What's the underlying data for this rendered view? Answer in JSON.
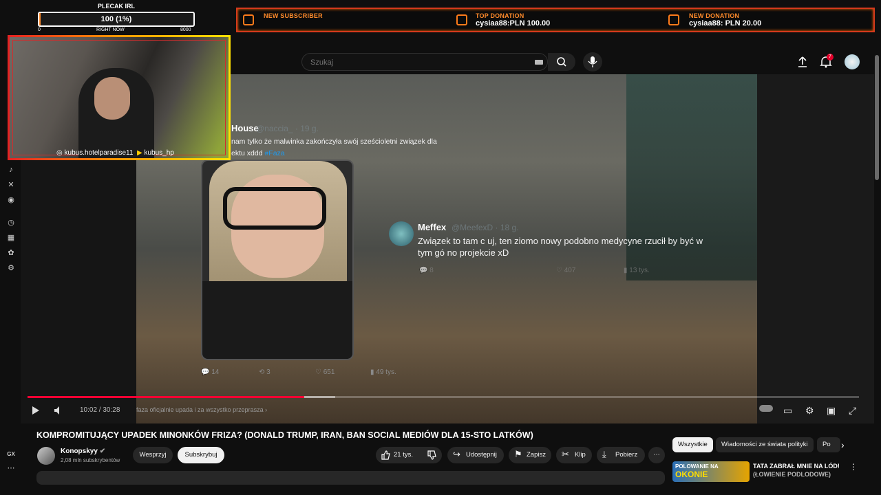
{
  "overlay": {
    "hud": {
      "title": "PLECAK IRL",
      "value_text": "100 (1%)",
      "progress_fraction": 0.01,
      "min_label": "0",
      "mid_label": "RIGHT NOW",
      "max_label": "8000"
    },
    "alerts": [
      {
        "title": "NEW SUBSCRIBER",
        "value": ""
      },
      {
        "title": "TOP DONATION",
        "value": "cysiaa88:PLN 100.00"
      },
      {
        "title": "NEW DONATION",
        "value": "cysiaa88: PLN 20.00"
      }
    ],
    "cam": {
      "instagram": "kubus.hotelparadise11",
      "youtube": "kubus_hp"
    },
    "accent_color": "#ff8a2a"
  },
  "left_rail": {
    "bottom_label": "GX"
  },
  "header": {
    "search_placeholder": "Szukaj",
    "notification_count": "7"
  },
  "video": {
    "tweet1": {
      "name": "House",
      "handle": "@naccia_ · 19 g.",
      "text_1": "nam tylko że malwinka zakończyła swój sześcioletni związek dla",
      "text_2": "ektu xddd",
      "hashtag": "#Faza",
      "stats": {
        "replies": "14",
        "retweets": "3",
        "likes": "651",
        "views": "49 tys."
      }
    },
    "tweet2": {
      "name": "Meffex",
      "handle": "@MeefexD · 18 g.",
      "text_1": "Związek to tam c   uj, ten ziomo nowy podobno medycyne rzucił by być w",
      "text_2": "tym gó    no projekcie xD",
      "stats": {
        "replies": "8",
        "likes": "407",
        "views": "13 tys."
      }
    },
    "time": "10:02 / 30:28",
    "chapter": "faza oficjalnie upada i za wszystko przeprasza",
    "played_fraction": 0.333,
    "buffered_fraction": 0.37
  },
  "meta": {
    "title": "KOMPROMITUJĄCY UPADEK MINONKÓW FRIZA? (DONALD TRUMP, IRAN, BAN SOCIAL MEDIÓW DLA 15-STO LATKÓW)",
    "channel": "Konopskyy",
    "subs": "2,08 mln subskrybentów",
    "support": "Wesprzyj",
    "subscribe": "Subskrybuj",
    "likes": "21 tys.",
    "share": "Udostępnij",
    "save": "Zapisz",
    "clip": "Klip",
    "download": "Pobierz"
  },
  "chips": [
    "Wszystkie",
    "Wiadomości ze świata polityki",
    "Po"
  ],
  "recommendation": {
    "thumb_top": "POLOWANIE NA",
    "thumb_big": "OKONIE",
    "title_1": "TATA ZABRAŁ MNIE NA LÓD!",
    "title_2": "(ŁOWIENIE PODLODOWE)"
  }
}
